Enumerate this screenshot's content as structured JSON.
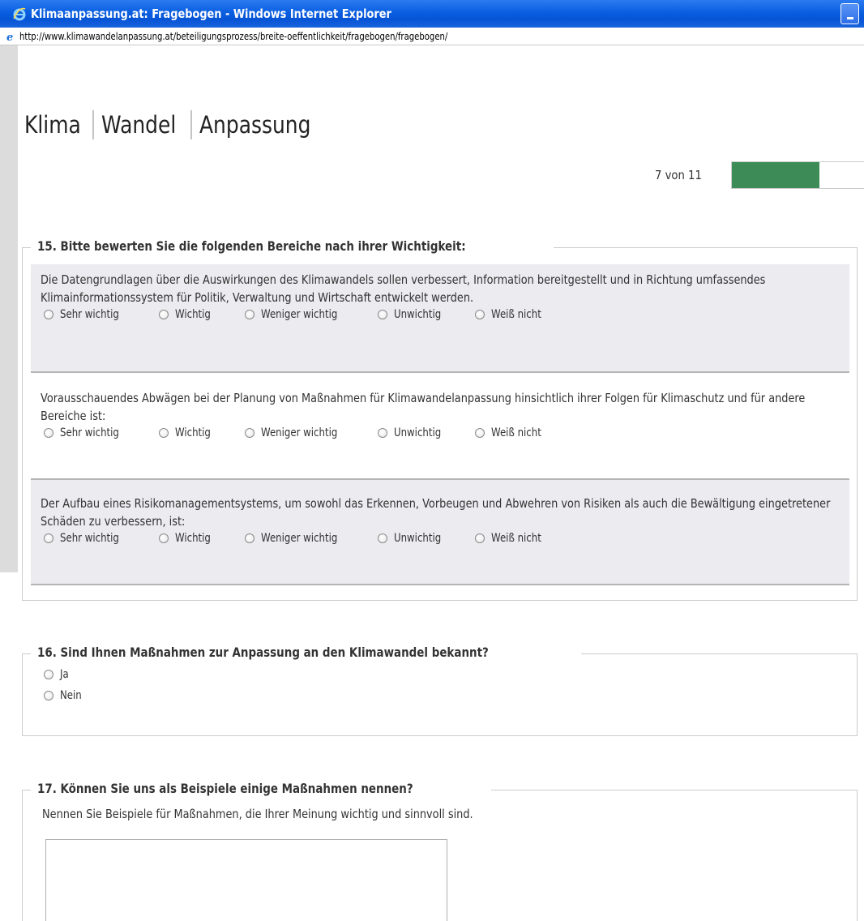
{
  "window": {
    "title": "Klimaanpassung.at: Fragebogen - Windows Internet Explorer",
    "url": "http://www.klimawandelanpassung.at/beteiligungsprozess/breite-oeffentlichkeit/fragebogen/fragebogen/"
  },
  "logo": {
    "part1": "Klima",
    "part2": "Wandel",
    "part3": "Anpassung"
  },
  "progress": {
    "label": "7 von 11",
    "fraction": 0.636,
    "color": "#3d8c57"
  },
  "q15": {
    "title": "15. Bitte bewerten Sie die folgenden Bereiche nach ihrer Wichtigkeit:",
    "items": [
      {
        "text": "Die Datengrundlagen über die Auswirkungen des Klimawandels sollen verbessert, Information bereitgestellt und in Richtung umfassendes Klimainformationssystem für Politik, Verwaltung und Wirtschaft entwickelt werden."
      },
      {
        "text": "Vorausschauendes Abwägen bei der Planung von Maßnahmen für Klimawandelanpassung hinsichtlich ihrer Folgen für Klimaschutz und für andere Bereiche ist:"
      },
      {
        "text": "Der Aufbau eines Risikomanagementsystems, um sowohl das Erkennen, Vorbeugen und Abwehren von Risiken als auch die Bewältigung eingetretener Schäden zu verbessern, ist:"
      }
    ],
    "options": [
      "Sehr wichtig",
      "Wichtig",
      "Weniger wichtig",
      "Unwichtig",
      "Weiß nicht"
    ]
  },
  "q16": {
    "title": "16. Sind Ihnen Maßnahmen zur Anpassung an den Klimawandel bekannt?",
    "options": [
      "Ja",
      "Nein"
    ]
  },
  "q17": {
    "title": "17. Können Sie uns als Beispiele einige Maßnahmen nennen?",
    "hint": "Nennen Sie Beispiele für Maßnahmen, die Ihrer Meinung wichtig und sinnvoll sind.",
    "answer": ""
  }
}
